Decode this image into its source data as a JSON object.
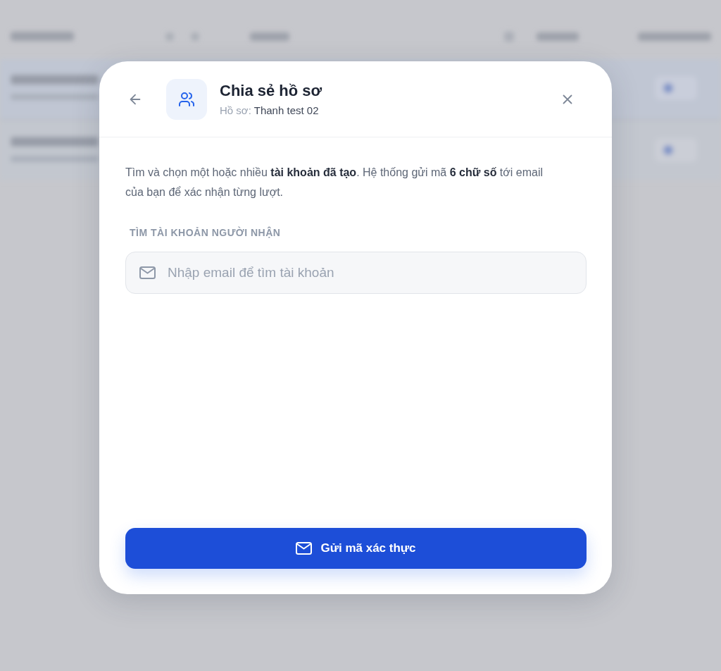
{
  "dialog": {
    "title": "Chia sẻ hồ sơ",
    "subtitle": {
      "label": "Hồ sơ:",
      "value": "Thanh test 02"
    },
    "description": "Tìm và chọn một hoặc nhiều **tài khoản đã tạo**. Hệ thống gửi mã **6 chữ số** tới email của bạn để xác nhận từng lượt.",
    "search": {
      "label": "TÌM TÀI KHOẢN NGƯỜI NHẬN",
      "placeholder": "Nhập email để tìm tài khoản"
    },
    "submit_button": "Gửi mã xác thực"
  }
}
